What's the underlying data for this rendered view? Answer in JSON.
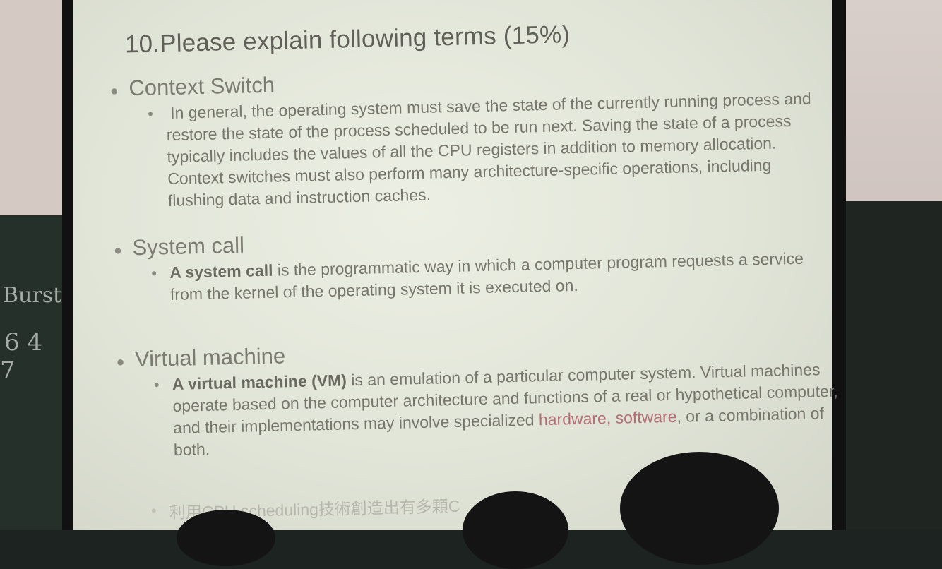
{
  "slide": {
    "title": "10.Please explain following terms (15%)",
    "sections": [
      {
        "heading": "Context Switch",
        "text": "In general, the operating system must save the state of the currently running process and restore the state of the process scheduled to be run next. Saving the state of a process typically includes the values of all the CPU registers in addition to memory allocation. Context switches must also perform many architecture-specific operations, including flushing data and instruction caches."
      },
      {
        "heading": "System call",
        "text_bold": "A system call",
        "text_rest": " is the programmatic way in which a computer program requests a service from the kernel of the operating system it is executed on."
      },
      {
        "heading": "Virtual machine",
        "text_bold": "A virtual machine (VM)",
        "text_rest": " is an emulation of a particular computer system. Virtual machines operate based on the computer architecture and functions of a real or hypothetical computer, and their implementations may involve specialized ",
        "text_highlight": "hardware, software",
        "text_end": ", or a combination of both."
      }
    ],
    "footnote": "利用CPU scheduling技術創造出有多顆C"
  },
  "chalkboard": {
    "scribble": "Burst",
    "digits_1": "6 4",
    "digits_2": "7"
  }
}
